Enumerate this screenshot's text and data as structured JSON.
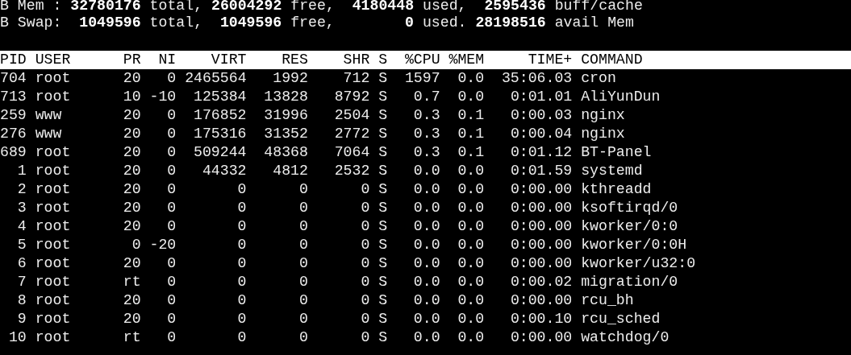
{
  "summary": [
    "B Mem : **32780176** total, **26004292** free,  **4180448** used,  **2595436** buff/cache",
    "B Swap:  **1049596** total,  **1049596** free,        **0** used. **28198516** avail Mem"
  ],
  "table": {
    "columns": [
      "PID",
      "USER",
      "PR",
      "NI",
      "VIRT",
      "RES",
      "SHR",
      "S",
      "%CPU",
      "%MEM",
      "TIME+",
      "COMMAND"
    ],
    "rows": [
      [
        "704",
        "root",
        "20",
        "0",
        "2465564",
        "1992",
        "712",
        "S",
        "1597",
        "0.0",
        "35:06.03",
        "cron"
      ],
      [
        "713",
        "root",
        "10",
        "-10",
        "125384",
        "13828",
        "8792",
        "S",
        "0.7",
        "0.0",
        "0:01.01",
        "AliYunDun"
      ],
      [
        "259",
        "www",
        "20",
        "0",
        "176852",
        "31996",
        "2504",
        "S",
        "0.3",
        "0.1",
        "0:00.03",
        "nginx"
      ],
      [
        "276",
        "www",
        "20",
        "0",
        "175316",
        "31352",
        "2772",
        "S",
        "0.3",
        "0.1",
        "0:00.04",
        "nginx"
      ],
      [
        "689",
        "root",
        "20",
        "0",
        "509244",
        "48368",
        "7064",
        "S",
        "0.3",
        "0.1",
        "0:01.12",
        "BT-Panel"
      ],
      [
        "1",
        "root",
        "20",
        "0",
        "44332",
        "4812",
        "2532",
        "S",
        "0.0",
        "0.0",
        "0:01.59",
        "systemd"
      ],
      [
        "2",
        "root",
        "20",
        "0",
        "0",
        "0",
        "0",
        "S",
        "0.0",
        "0.0",
        "0:00.00",
        "kthreadd"
      ],
      [
        "3",
        "root",
        "20",
        "0",
        "0",
        "0",
        "0",
        "S",
        "0.0",
        "0.0",
        "0:00.00",
        "ksoftirqd/0"
      ],
      [
        "4",
        "root",
        "20",
        "0",
        "0",
        "0",
        "0",
        "S",
        "0.0",
        "0.0",
        "0:00.00",
        "kworker/0:0"
      ],
      [
        "5",
        "root",
        "0",
        "-20",
        "0",
        "0",
        "0",
        "S",
        "0.0",
        "0.0",
        "0:00.00",
        "kworker/0:0H"
      ],
      [
        "6",
        "root",
        "20",
        "0",
        "0",
        "0",
        "0",
        "S",
        "0.0",
        "0.0",
        "0:00.00",
        "kworker/u32:0"
      ],
      [
        "7",
        "root",
        "rt",
        "0",
        "0",
        "0",
        "0",
        "S",
        "0.0",
        "0.0",
        "0:00.02",
        "migration/0"
      ],
      [
        "8",
        "root",
        "20",
        "0",
        "0",
        "0",
        "0",
        "S",
        "0.0",
        "0.0",
        "0:00.00",
        "rcu_bh"
      ],
      [
        "9",
        "root",
        "20",
        "0",
        "0",
        "0",
        "0",
        "S",
        "0.0",
        "0.0",
        "0:00.10",
        "rcu_sched"
      ],
      [
        "10",
        "root",
        "rt",
        "0",
        "0",
        "0",
        "0",
        "S",
        "0.0",
        "0.0",
        "0:00.00",
        "watchdog/0"
      ]
    ]
  }
}
